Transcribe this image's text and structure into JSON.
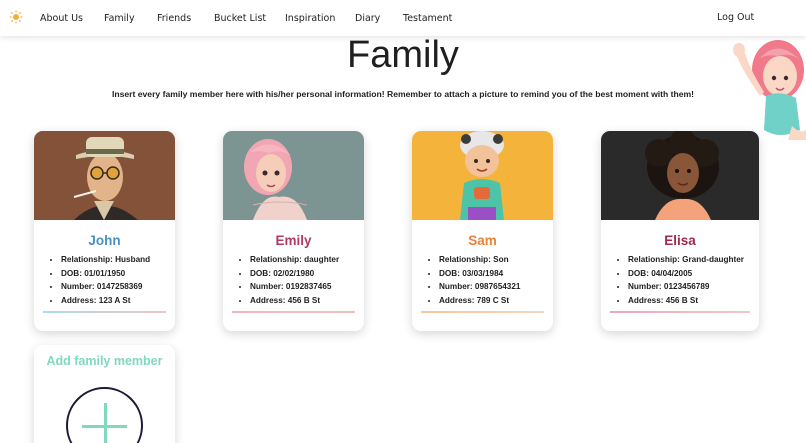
{
  "nav": {
    "logo_icon": "sun-icon",
    "items": [
      "About Us",
      "Family",
      "Friends",
      "Bucket List",
      "Inspiration",
      "Diary",
      "Testament"
    ],
    "logout": "Log Out"
  },
  "page": {
    "title": "Family",
    "subtitle": "Insert every family member here with his/her personal information! Remember to attach a picture to remind you of the best moment with them!"
  },
  "members": [
    {
      "name": "John",
      "name_color": "#4a90c2",
      "relationship": "Relationship: Husband",
      "dob": "DOB: 01/01/1950",
      "number": "Number: 0147258369",
      "address": "Address: 123 A St",
      "line_colors": [
        "#a8dcea",
        "#f0c6c2"
      ]
    },
    {
      "name": "Emily",
      "name_color": "#b23a62",
      "relationship": "Relationship: daughter",
      "dob": "DOB: 02/02/1980",
      "number": "Number: 0192837465",
      "address": "Address: 456 B St",
      "line_colors": [
        "#f2b5c4",
        "#e9c4b6"
      ]
    },
    {
      "name": "Sam",
      "name_color": "#e8813a",
      "relationship": "Relationship: Son",
      "dob": "DOB: 03/03/1984",
      "number": "Number: 0987654321",
      "address": "Address: 789 C St",
      "line_colors": [
        "#f7c59c",
        "#f4d7c0"
      ]
    },
    {
      "name": "Elisa",
      "name_color": "#a0284b",
      "relationship": "Relationship: Grand-daughter",
      "dob": "DOB: 04/04/2005",
      "number": "Number: 0123456789",
      "address": "Address: 456 B St",
      "line_colors": [
        "#e8a9bb",
        "#f1c9c9"
      ]
    }
  ],
  "add_card": {
    "title": "Add family member",
    "icon": "plus-icon"
  }
}
